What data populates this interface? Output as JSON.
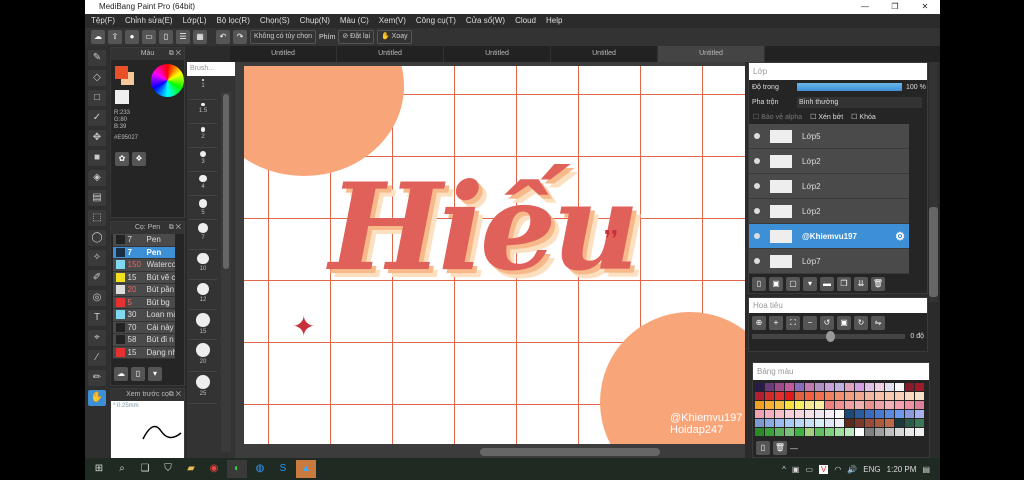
{
  "window": {
    "title": "MediBang Paint Pro (64bit)",
    "min": "—",
    "max": "❐",
    "close": "✕"
  },
  "menu": [
    "Tệp(F)",
    "Chỉnh sửa(E)",
    "Lớp(L)",
    "Bộ lọc(R)",
    "Chọn(S)",
    "Chụp(N)",
    "Màu (C)",
    "Xem(V)",
    "Công cụ(T)",
    "Cửa sổ(W)",
    "Cloud",
    "Help"
  ],
  "toolbar": {
    "no_option": "Không có tùy chọn",
    "key_label": "Phím",
    "reset": "Đặt lại",
    "rotate": "Xoay"
  },
  "tabs": [
    "Untitled",
    "Untitled",
    "Untitled",
    "Untitled",
    "Untitled"
  ],
  "color_panel": {
    "title": "Màu",
    "r": "R:233",
    "g": "G:80",
    "b": "B:39",
    "hex": "#E95027",
    "primary": "#e95027",
    "secondary": "#f5c89a"
  },
  "brush_size": {
    "label": "Brush...",
    "sizes": [
      "1",
      "1.5",
      "2",
      "3",
      "4",
      "5",
      "7",
      "10",
      "12",
      "15",
      "20",
      "25"
    ]
  },
  "brush_panel": {
    "title": "Cọ: Pen",
    "items": [
      {
        "size": "7",
        "name": "Pen",
        "color": "#222"
      },
      {
        "size": "7",
        "name": "Pen",
        "color": "#1c2e44"
      },
      {
        "size": "150",
        "name": "Waterco",
        "color": "#7fd8f0"
      },
      {
        "size": "15",
        "name": "Bút vẽ c",
        "color": "#f0e020"
      },
      {
        "size": "20",
        "name": "Bút pần",
        "color": "#ddd"
      },
      {
        "size": "5",
        "name": "Bút bg",
        "color": "#e83030"
      },
      {
        "size": "30",
        "name": "Loan mà",
        "color": "#7fd8f0"
      },
      {
        "size": "70",
        "name": "Cái này c",
        "color": "#222"
      },
      {
        "size": "58",
        "name": "Bút đi n",
        "color": "#222"
      },
      {
        "size": "15",
        "name": "Dạng nh",
        "color": "#e83030"
      }
    ]
  },
  "preview_panel": {
    "title": "Xem trước cọ",
    "size": "* 0.25mm"
  },
  "layer_panel": {
    "title": "Lớp",
    "opacity_label": "Độ trong",
    "opacity_value": "100 %",
    "opacity": 1.0,
    "blend_label": "Pha trộn",
    "blend_value": "Bình thường",
    "protect_alpha": "Bảo vệ alpha",
    "clipping": "Xén bớt",
    "lock": "Khóa",
    "layers": [
      "Lớp5",
      "Lớp2",
      "Lớp2",
      "Lớp2",
      "@Khiemvu197",
      "Lớp7"
    ]
  },
  "navigator": {
    "title": "Hoa tiêu",
    "angle": "0 độ"
  },
  "palette": {
    "title": "Bảng màu",
    "footer": "—",
    "colors": [
      "#2a1a4a",
      "#6a3a7a",
      "#a04a8a",
      "#c05a9a",
      "#8a6aba",
      "#c07ab0",
      "#b090c0",
      "#c8a0d8",
      "#c0b0e0",
      "#e0a0c0",
      "#d0a0e0",
      "#e0c0e8",
      "#f0d0e0",
      "#e0e0f0",
      "#f8f8f8",
      "#8a1a2a",
      "#a01a2a",
      "#b02030",
      "#d02a2a",
      "#e03030",
      "#e01a1a",
      "#e06040",
      "#f06040",
      "#f07050",
      "#f08060",
      "#f09070",
      "#f0a080",
      "#f0a890",
      "#f0b8a0",
      "#f8c0a8",
      "#f8c8b0",
      "#f8d0b8",
      "#f8d8c0",
      "#f8e0c8",
      "#f0a020",
      "#f8b030",
      "#f8c040",
      "#f8e040",
      "#f8f060",
      "#f8e890",
      "#f8f0a0",
      "#f08080",
      "#f09090",
      "#f0a0a0",
      "#f0b0b0",
      "#e89090",
      "#f0a0a8",
      "#f8b0b8",
      "#f8a0b0",
      "#f090a0",
      "#e08098",
      "#f0a0b0",
      "#f8b0c0",
      "#f8c0c8",
      "#f8d0d8",
      "#f8d8e0",
      "#f8e0e8",
      "#f0e8f0",
      "#f8f0f8",
      "#ffffff",
      "#1a4a7a",
      "#2a5aa0",
      "#3a6ac0",
      "#4a7ad0",
      "#5a8ae0",
      "#6a9af0",
      "#8a9ae0",
      "#aab0f0",
      "#7a9ad0",
      "#8aaae0",
      "#9abaf0",
      "#aacaf8",
      "#bad8f8",
      "#cae0f8",
      "#daf0f8",
      "#e0e8f8",
      "#f0f0f8",
      "#5a2a1a",
      "#7a3a2a",
      "#9a4a3a",
      "#aa5a3a",
      "#ba6a4a",
      "#1a3a3a",
      "#2a5a4a",
      "#3a7a5a",
      "#2a8a2a",
      "#3aa03a",
      "#5ab05a",
      "#7ac07a",
      "#40b040",
      "#a0d080",
      "#60c060",
      "#80d080",
      "#a0e0a0",
      "#c0e8c0",
      "#ffffff",
      "#808080",
      "#a0a0a0",
      "#c0c0c0",
      "#d8d8d8",
      "#e8e8e8",
      "#f0f0f0"
    ]
  },
  "canvas": {
    "lettering": "Hiếu",
    "watermark1": "@Khiemvu197",
    "watermark2": "Hoidap247",
    "bg_shape_color": "#f9a57a",
    "grid_color": "#e2674a"
  },
  "taskbar": {
    "lang": "ENG",
    "time": "1:20 PM"
  }
}
